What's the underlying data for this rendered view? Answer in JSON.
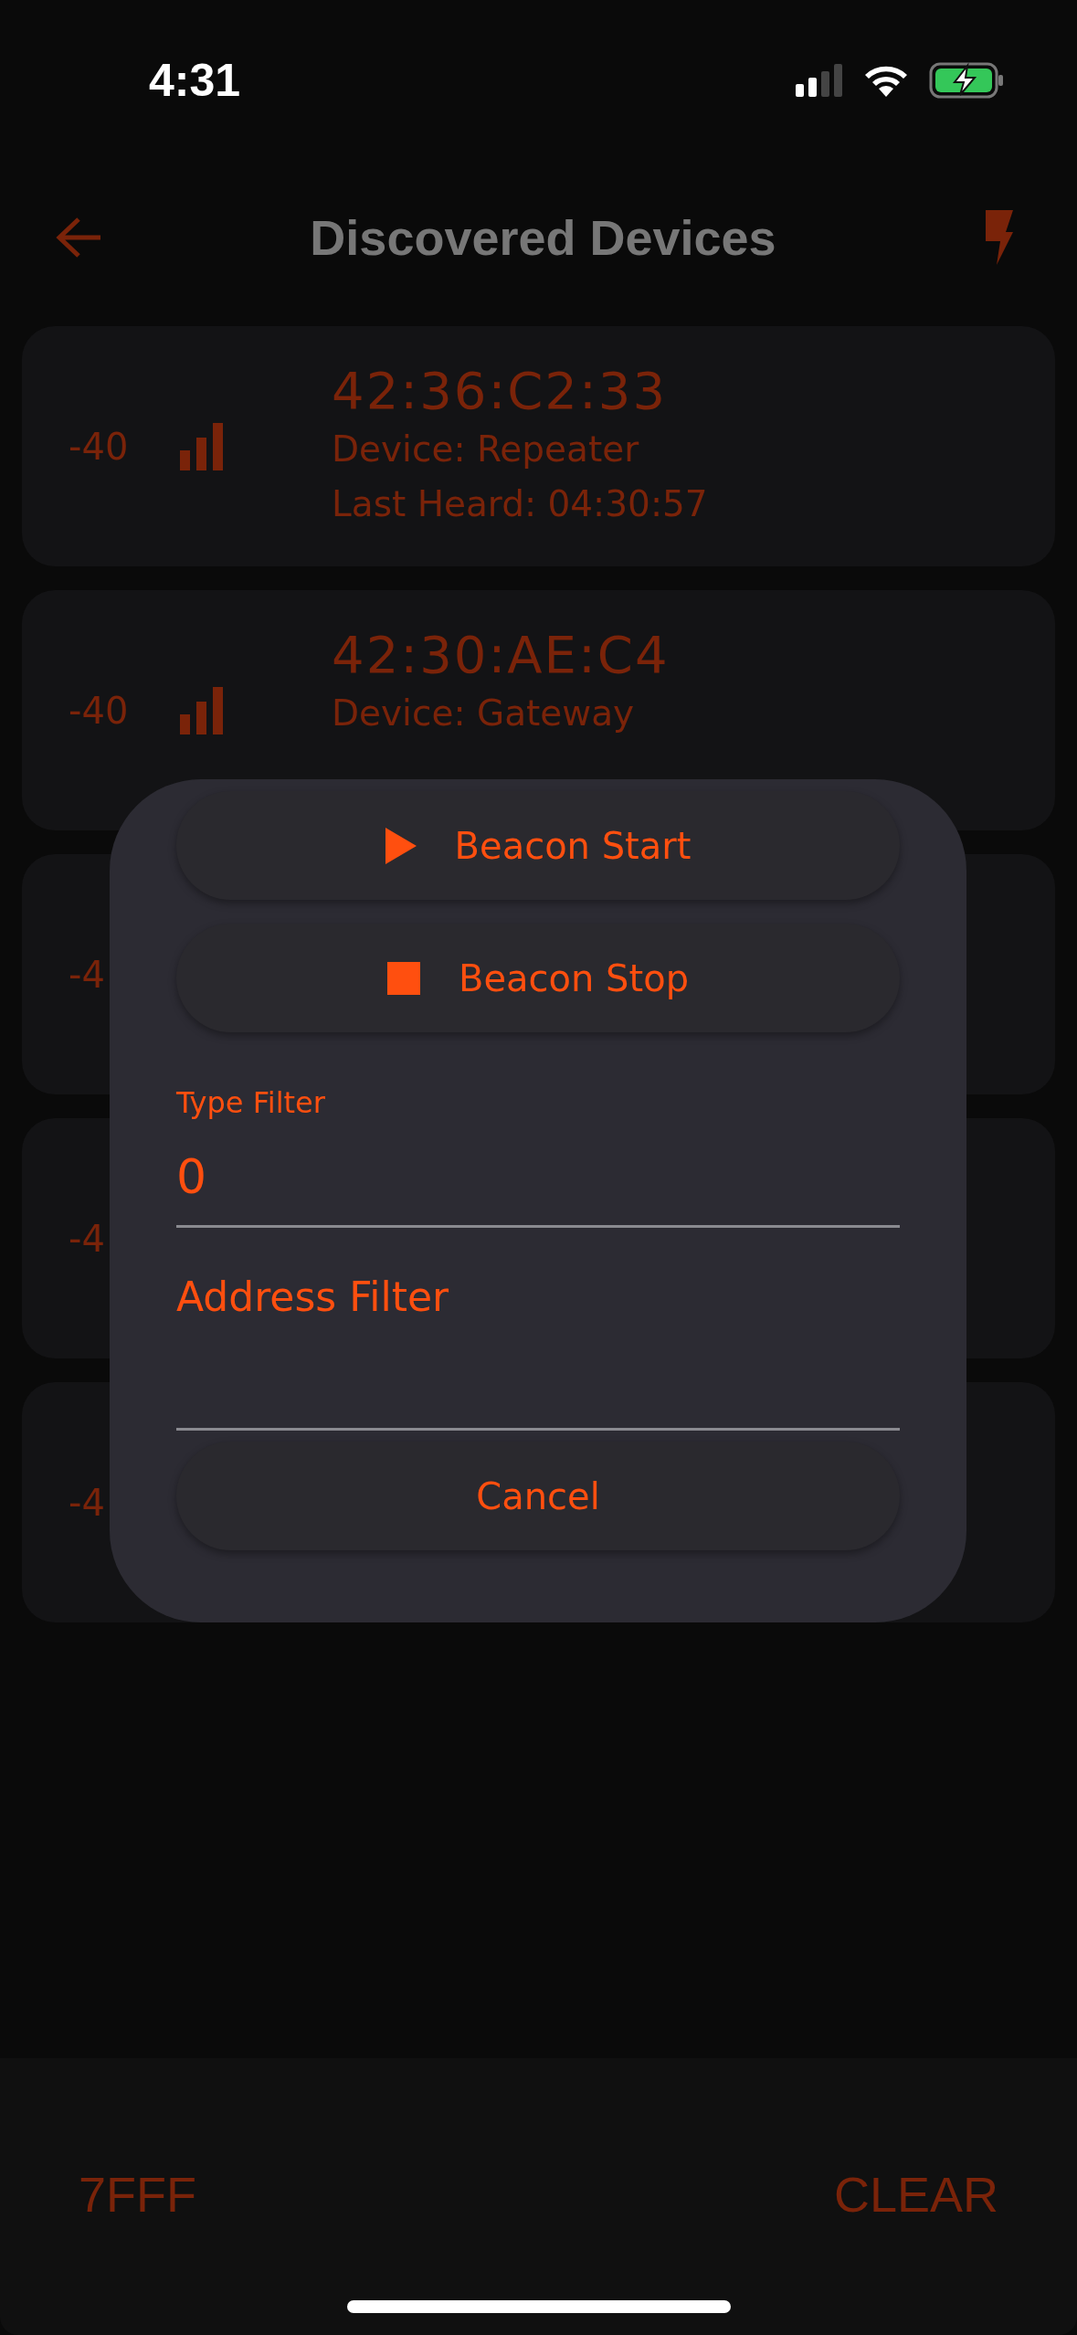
{
  "status_bar": {
    "time": "4:31"
  },
  "header": {
    "title": "Discovered Devices"
  },
  "devices": [
    {
      "rssi": "-40",
      "address": "42:36:C2:33",
      "detail": "Device: Repeater",
      "last_heard": "Last Heard: 04:30:57"
    },
    {
      "rssi": "-40",
      "address": "42:30:AE:C4",
      "detail": "Device: Gateway"
    },
    {
      "rssi": "-4"
    },
    {
      "rssi": "-4"
    },
    {
      "rssi": "-4"
    }
  ],
  "dialog": {
    "buttons": [
      {
        "kind": "start",
        "label": "Beacon Start"
      },
      {
        "kind": "stop",
        "label": "Beacon Stop"
      }
    ],
    "type_filter": {
      "label": "Type Filter",
      "value": "0"
    },
    "address_filter": {
      "placeholder": "Address Filter"
    },
    "cancel": "Cancel"
  },
  "bottom_bar": {
    "left": "7FFF",
    "right": "CLEAR"
  }
}
